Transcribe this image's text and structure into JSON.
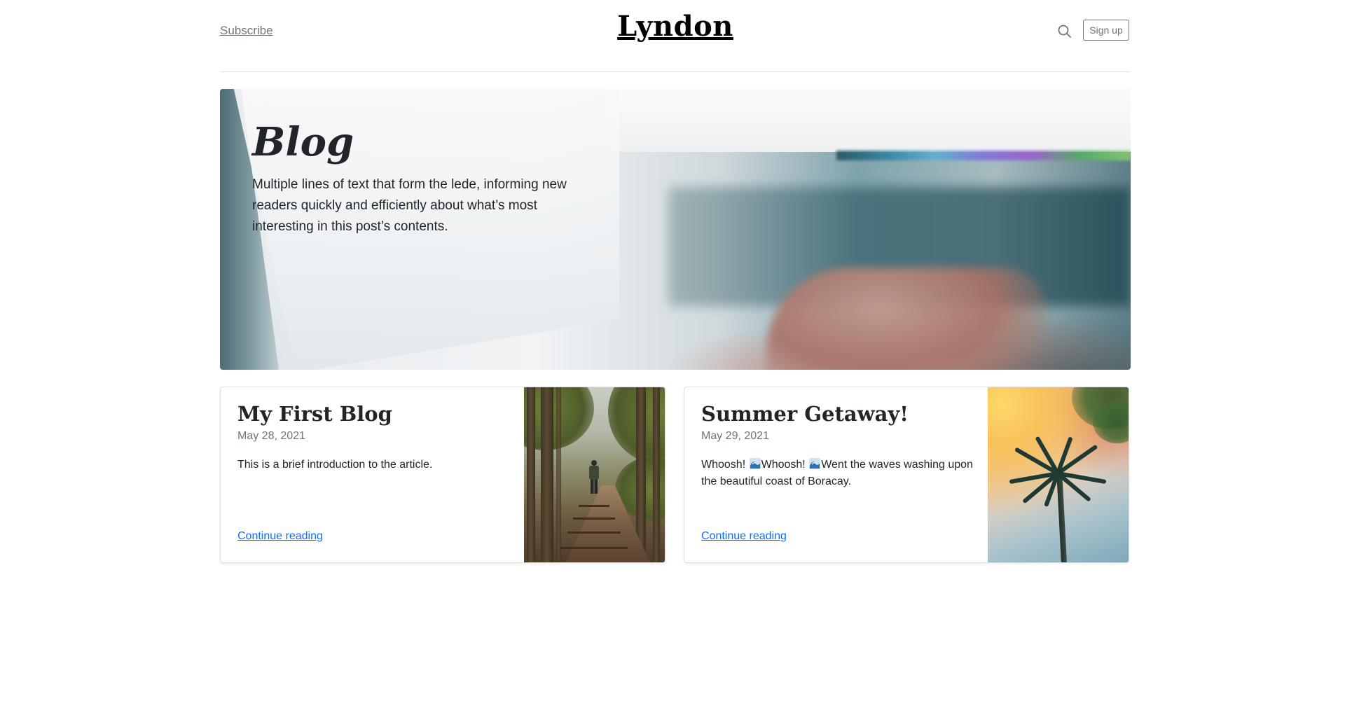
{
  "header": {
    "subscribe_label": "Subscribe",
    "site_title": "Lyndon",
    "search_icon": "search-icon",
    "signup_label": "Sign up"
  },
  "hero": {
    "title": "Blog",
    "lede": "Multiple lines of text that form the lede, informing new readers quickly and efficiently about what’s most interesting in this post’s contents."
  },
  "posts": [
    {
      "title": "My First Blog",
      "date": "May 28, 2021",
      "excerpt": "This is a brief introduction to the article.",
      "link_label": "Continue reading",
      "image": "forest-path-hiker"
    },
    {
      "title": "Summer Getaway!",
      "date": "May 29, 2021",
      "excerpt_parts": [
        "Whoosh! ",
        "Whoosh! ",
        "Went the waves washing upon the beautiful coast of Boracay."
      ],
      "excerpt_icon": "wave-emoji-icon",
      "link_label": "Continue reading",
      "image": "palm-tree-sunset"
    }
  ],
  "colors": {
    "link": "#0d6efd",
    "muted": "#6c757d",
    "text": "#212529",
    "border": "#dee2e6"
  }
}
